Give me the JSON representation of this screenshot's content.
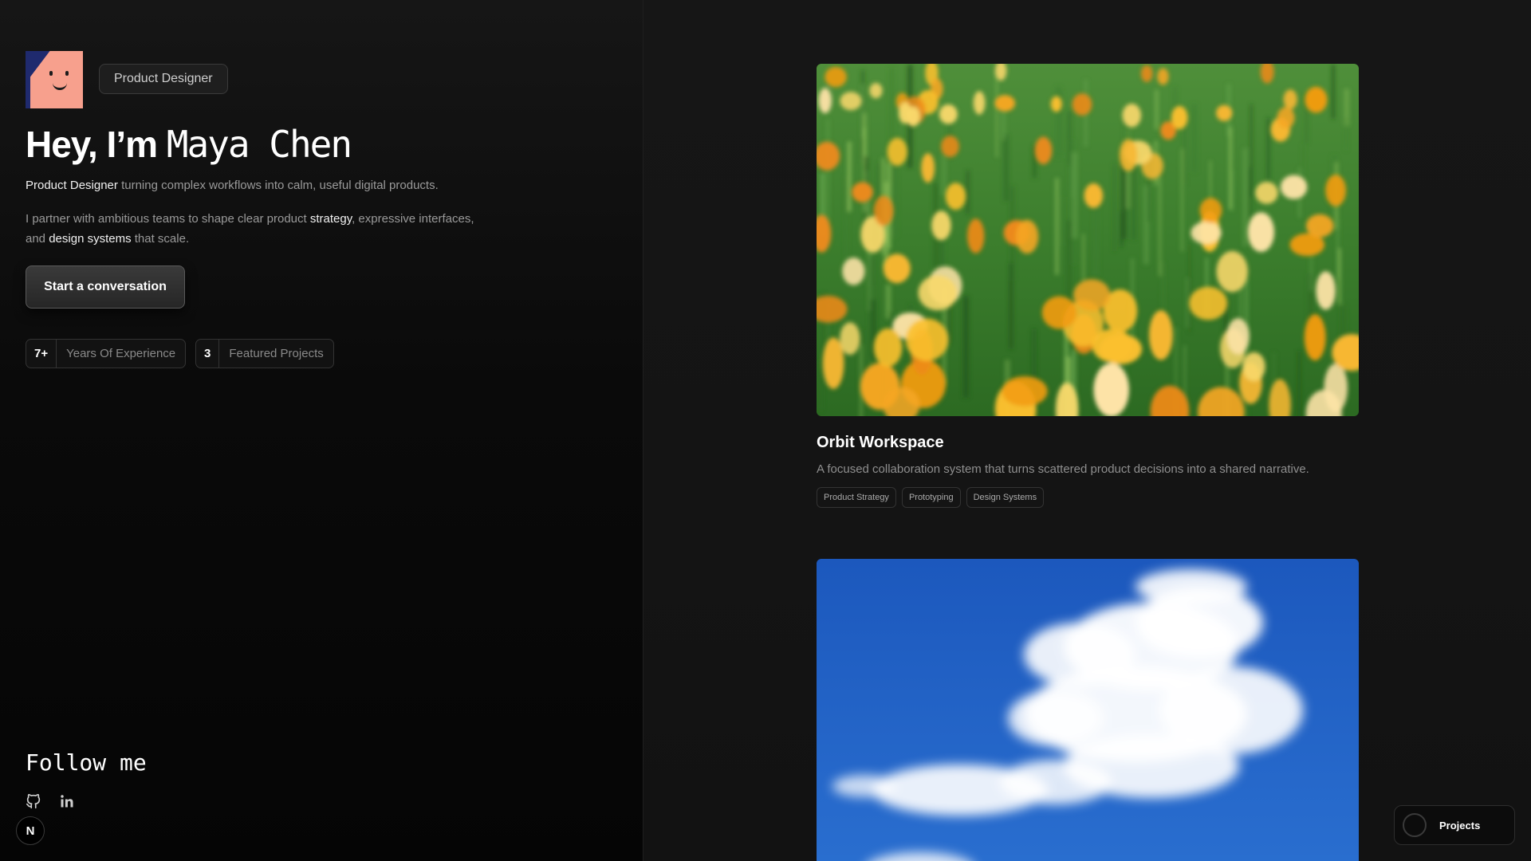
{
  "profile": {
    "role": "Product Designer",
    "greeting": "Hey, I’m",
    "name": "Maya Chen",
    "tagline_highlight": "Product Designer",
    "tagline_rest": " turning complex workflows into calm, useful digital products.",
    "bio_1": "I partner with ambitious teams to shape clear product ",
    "bio_strategy": "strategy",
    "bio_2": ", expressive interfaces, and ",
    "bio_design_systems": "design systems",
    "bio_3": " that scale.",
    "cta_label": "Start a conversation"
  },
  "stats": [
    {
      "value": "7+",
      "label": "Years Of Experience"
    },
    {
      "value": "3",
      "label": "Featured Projects"
    }
  ],
  "follow": {
    "title": "Follow me",
    "icons": [
      "github-icon",
      "linkedin-icon"
    ]
  },
  "badge": {
    "letter": "N"
  },
  "projects": [
    {
      "title": "Orbit Workspace",
      "description": "A focused collaboration system that turns scattered product decisions into a shared narrative.",
      "tags": [
        "Product Strategy",
        "Prototyping",
        "Design Systems"
      ]
    }
  ],
  "projects_button": {
    "label": "Projects"
  },
  "colors": {
    "background": "#0e0e0e",
    "avatar_bg": "#1f2a6e",
    "avatar_face": "#f7a08d",
    "sky": "#1f5fc2"
  }
}
